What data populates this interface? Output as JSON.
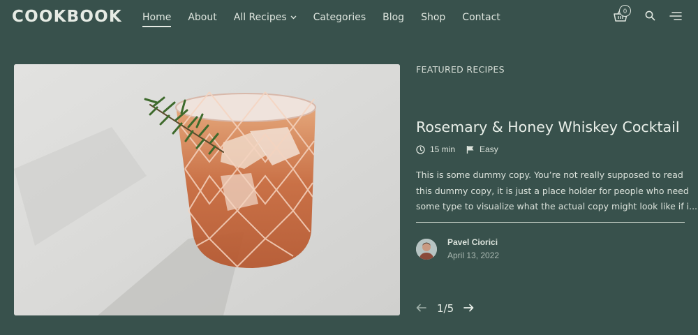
{
  "header": {
    "logo": "COOKBOOK",
    "nav": [
      {
        "label": "Home",
        "active": true
      },
      {
        "label": "About"
      },
      {
        "label": "All Recipes",
        "dropdown": true
      },
      {
        "label": "Categories"
      },
      {
        "label": "Blog"
      },
      {
        "label": "Shop"
      },
      {
        "label": "Contact"
      }
    ],
    "cart_count": "0",
    "icons": [
      "cart-icon",
      "search-icon",
      "menu-icon"
    ]
  },
  "featured": {
    "section_label": "FEATURED RECIPES",
    "title": "Rosemary & Honey Whiskey Cocktail",
    "time": "15 min",
    "difficulty": "Easy",
    "excerpt_lines": [
      "This is some dummy copy. You’re not really supposed to read",
      "this dummy copy, it is just a place holder for people who need",
      "some type to visualize what the actual copy might look like if i..."
    ],
    "author_name": "Pavel Ciorici",
    "date": "April 13, 2022",
    "pagination": "1/5"
  },
  "colors": {
    "background": "#38514c",
    "text": "#e9efe9"
  }
}
